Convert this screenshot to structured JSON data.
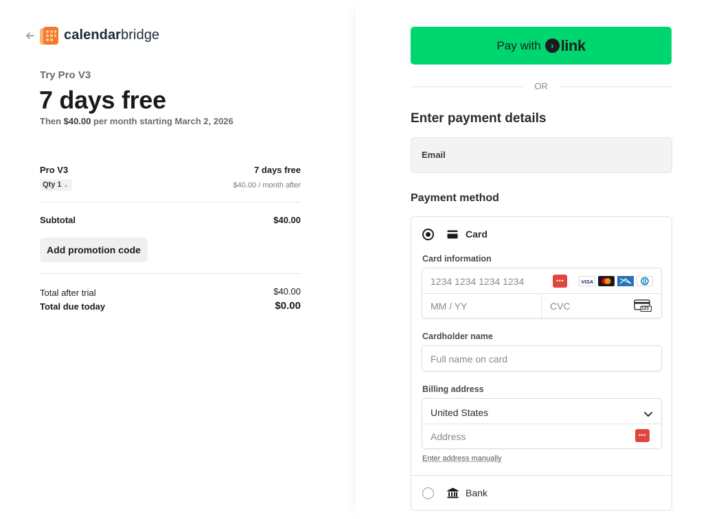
{
  "brand": {
    "name_bold": "calendar",
    "name_rest": "bridge"
  },
  "summary": {
    "plan_title": "Try Pro V3",
    "headline": "7 days free",
    "then_prefix": "Then ",
    "then_amount": "$40.00",
    "then_suffix": " per month starting March 2, 2026",
    "item_name": "Pro V3",
    "item_value": "7 days free",
    "qty_label": "Qty 1",
    "item_after": "$40.00 / month after",
    "subtotal_label": "Subtotal",
    "subtotal_value": "$40.00",
    "promo_button": "Add promotion code",
    "total_after_label": "Total after trial",
    "total_after_value": "$40.00",
    "due_today_label": "Total due today",
    "due_today_value": "$0.00"
  },
  "payment": {
    "link_prefix": "Pay with",
    "link_word": "link",
    "or_text": "OR",
    "heading": "Enter payment details",
    "email_placeholder": "Email",
    "method_heading": "Payment method",
    "card_label": "Card",
    "card_info_label": "Card information",
    "card_number_placeholder": "1234 1234 1234 1234",
    "expiry_placeholder": "MM / YY",
    "cvc_placeholder": "CVC",
    "cvc_icon_text": "123",
    "card_brands": [
      "VISA",
      "Mastercard",
      "American Express",
      "Diners Club"
    ],
    "cardholder_label": "Cardholder name",
    "cardholder_placeholder": "Full name on card",
    "billing_label": "Billing address",
    "country_value": "United States",
    "address_placeholder": "Address",
    "manual_link": "Enter address manually",
    "bank_label": "Bank"
  },
  "colors": {
    "link_green": "#00d66f",
    "logo_orange": "#f5792a",
    "autofill_red": "#e0463f"
  }
}
